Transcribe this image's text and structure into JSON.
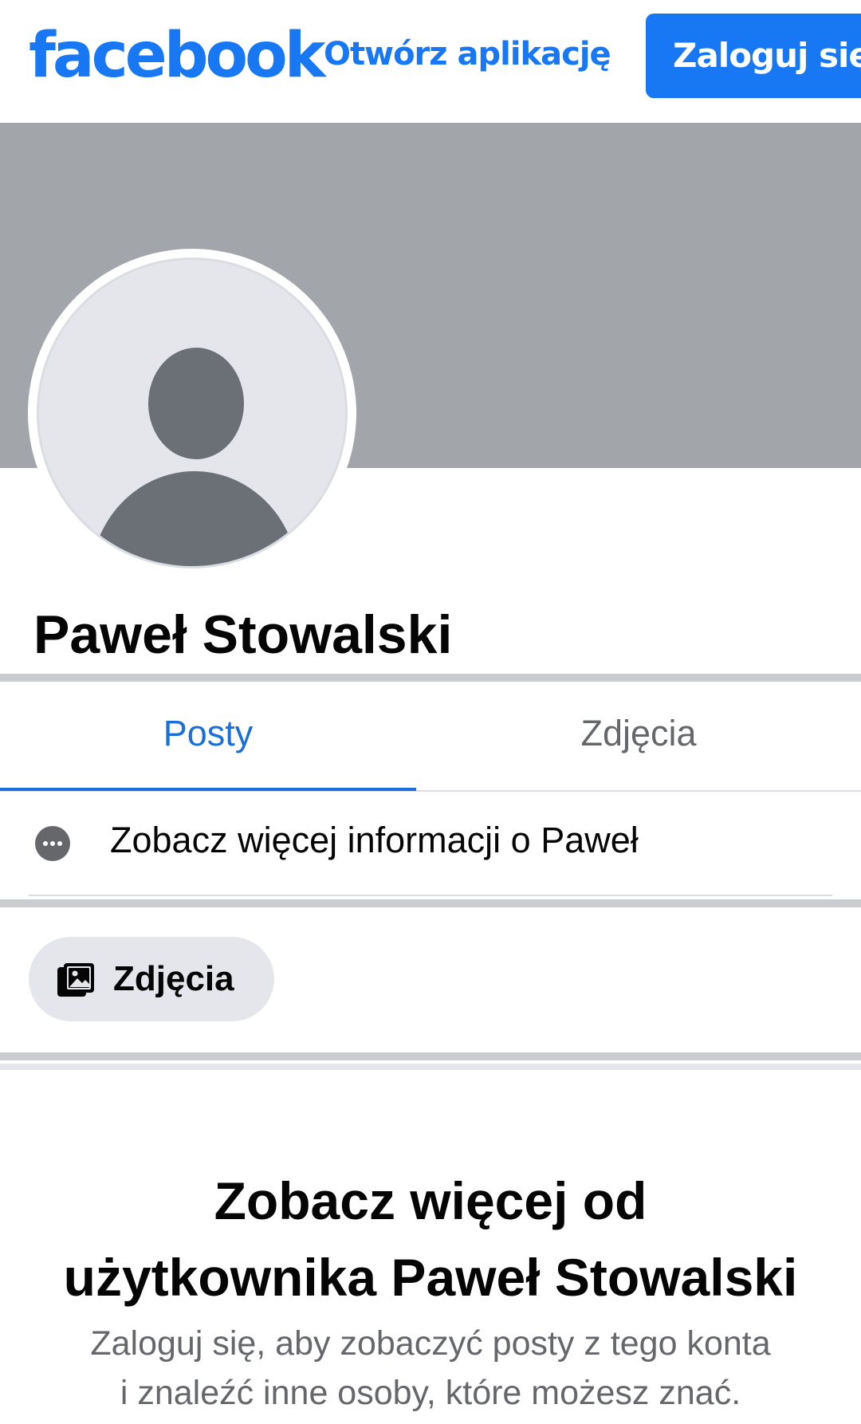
{
  "header": {
    "logo_text": "facebook",
    "open_app_label": "Otwórz aplikację",
    "login_label": "Zaloguj się"
  },
  "profile": {
    "name": "Paweł Stowalski"
  },
  "tabs": [
    {
      "label": "Posty",
      "active": true
    },
    {
      "label": "Zdjęcia",
      "active": false
    }
  ],
  "info_row": {
    "label": "Zobacz więcej informacji o Paweł",
    "icon": "more-dots-icon"
  },
  "photos_chip": {
    "label": "Zdjęcia",
    "icon": "photos-icon"
  },
  "cta": {
    "title_line1": "Zobacz więcej od",
    "title_line2": "użytkownika Paweł Stowalski",
    "subtitle_line1": "Zaloguj się, aby zobaczyć posty z tego konta",
    "subtitle_line2": "i znaleźć inne osoby, które możesz znać."
  },
  "colors": {
    "brand": "#1877f2",
    "cover": "#a2a5aa",
    "avatar_bg": "#e4e6eb",
    "avatar_fg": "#6b6f76",
    "secondary_text": "#65676b"
  }
}
